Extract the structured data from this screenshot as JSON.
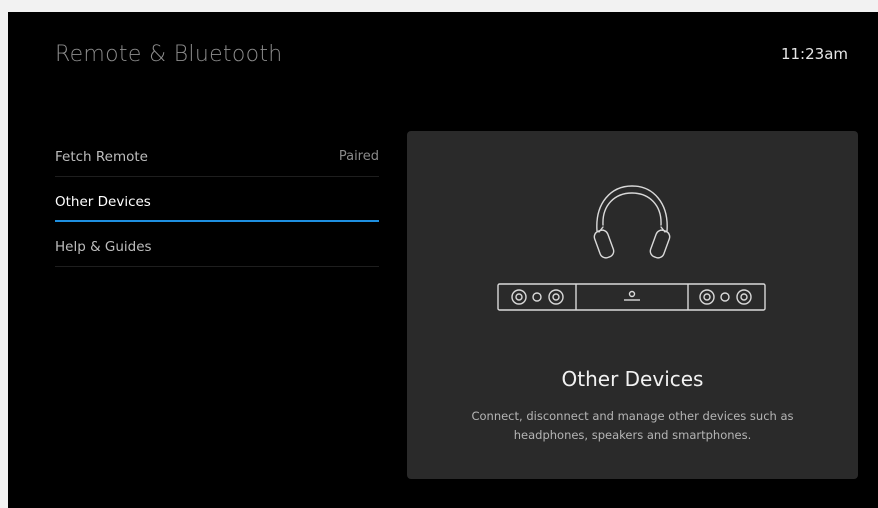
{
  "header": {
    "title": "Remote & Bluetooth",
    "time": "11:23am"
  },
  "menu": {
    "items": [
      {
        "label": "Fetch Remote",
        "status": "Paired",
        "selected": false
      },
      {
        "label": "Other Devices",
        "status": "",
        "selected": true
      },
      {
        "label": "Help & Guides",
        "status": "",
        "selected": false
      }
    ]
  },
  "detail": {
    "title": "Other Devices",
    "description": "Connect, disconnect and manage other devices such as headphones, speakers and smartphones.",
    "illustration": [
      "headphones-icon",
      "soundbar-icon"
    ]
  },
  "colors": {
    "background": "#000000",
    "panel": "#2a2a2a",
    "accent": "#1e8fe0"
  }
}
